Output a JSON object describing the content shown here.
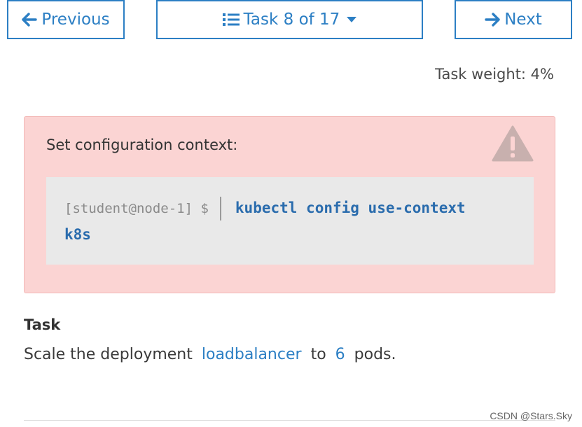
{
  "nav": {
    "previous_label": "Previous",
    "task_label": "Task 8 of 17",
    "next_label": "Next"
  },
  "task_weight": "Task weight: 4%",
  "context": {
    "title": "Set configuration context:",
    "prompt": "[student@node-1] $",
    "command_line1": "kubectl config use-context",
    "command_line2": "k8s"
  },
  "task": {
    "heading": "Task",
    "desc_prefix": "Scale the deployment",
    "deployment": "loadbalancer",
    "desc_mid": "to",
    "count": "6",
    "desc_suffix": "pods."
  },
  "watermark": "CSDN @Stars.Sky",
  "icons": {
    "previous": "arrow-left-icon",
    "task_list": "list-icon",
    "caret": "caret-down-icon",
    "next": "arrow-right-icon",
    "warning": "warning-triangle-icon"
  },
  "colors": {
    "accent": "#2c7fc4",
    "alert_background": "#fbd4d3",
    "code_background": "#e9e9e9",
    "warning_icon": "#c8b0ae"
  }
}
